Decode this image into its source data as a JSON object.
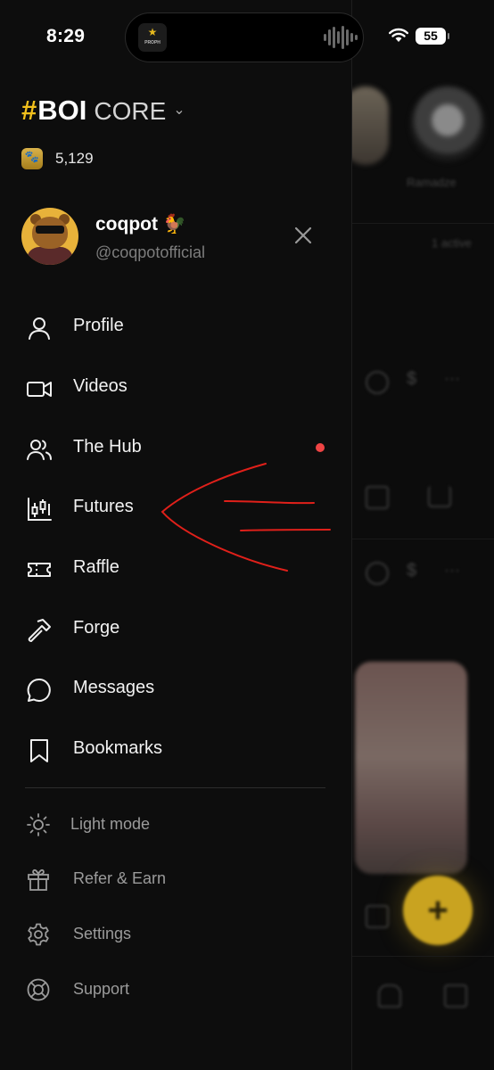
{
  "status_bar": {
    "time": "8:29",
    "battery": "55",
    "live_app_label": "PROPH"
  },
  "brand": {
    "hash": "#",
    "name": "BOI",
    "tier": "CORE"
  },
  "balance": {
    "value": "5,129"
  },
  "profile": {
    "name": "coqpot 🐓",
    "handle": "@coqpotofficial"
  },
  "menu": [
    {
      "label": "Profile",
      "icon": "user-icon"
    },
    {
      "label": "Videos",
      "icon": "video-camera-icon"
    },
    {
      "label": "The Hub",
      "icon": "users-icon",
      "has_notification": true
    },
    {
      "label": "Futures",
      "icon": "candlestick-chart-icon"
    },
    {
      "label": "Raffle",
      "icon": "ticket-icon"
    },
    {
      "label": "Forge",
      "icon": "hammer-icon"
    },
    {
      "label": "Messages",
      "icon": "chat-bubble-icon"
    },
    {
      "label": "Bookmarks",
      "icon": "bookmark-icon"
    }
  ],
  "secondary_menu": [
    {
      "label": "Light mode",
      "icon": "sun-icon"
    },
    {
      "label": "Refer & Earn",
      "icon": "gift-icon"
    },
    {
      "label": "Settings",
      "icon": "gear-icon"
    },
    {
      "label": "Support",
      "icon": "lifebuoy-icon"
    }
  ],
  "background": {
    "fab_label": "+",
    "text_1": "Ramadze",
    "text_2": "1 active"
  },
  "colors": {
    "accent": "#f2c01c",
    "notification": "#ef4444",
    "annotation": "#e0201a"
  }
}
